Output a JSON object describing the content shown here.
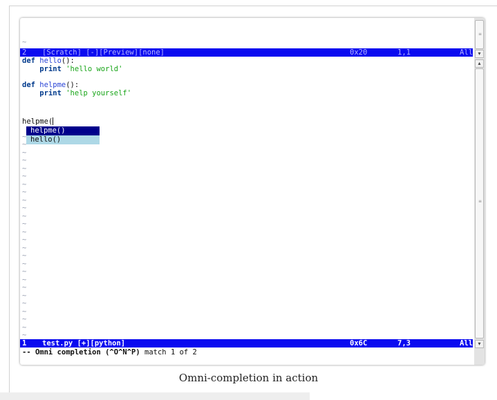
{
  "editor": {
    "preview_window": {
      "tilde": "~",
      "status": {
        "number": "2",
        "name": "[Scratch] [-][Preview][none]",
        "hex": "0x20",
        "position": "1,1",
        "scroll": "All"
      }
    },
    "buffer": {
      "lines": {
        "l1_kw": "def",
        "l1_fn": "hello",
        "l1_rest": "():",
        "l2_kw": "print",
        "l2_str": "'hello world'",
        "l4_kw": "def",
        "l4_fn": "helpme",
        "l4_rest": "():",
        "l5_kw": "print",
        "l5_str": "'help yourself'",
        "l7_text": "helpme("
      },
      "tilde": "~"
    },
    "completion_popup": {
      "items": [
        "helpme()",
        "hello()"
      ]
    },
    "status": {
      "number": "1",
      "name": "test.py [+][python]",
      "hex": "0x6C",
      "position": "7,3",
      "scroll": "All"
    },
    "cmdline": {
      "prefix": "-- Omni completion (^O^N^P) ",
      "match": "match 1 of 2"
    }
  },
  "caption": "Omni-completion in action",
  "colors": {
    "statusline": "#0a0af0",
    "popup_selected": "#00008b",
    "popup_normal": "#add8e6",
    "keyword": "#003a8c",
    "function": "#2a44d6",
    "string": "#19a519"
  }
}
